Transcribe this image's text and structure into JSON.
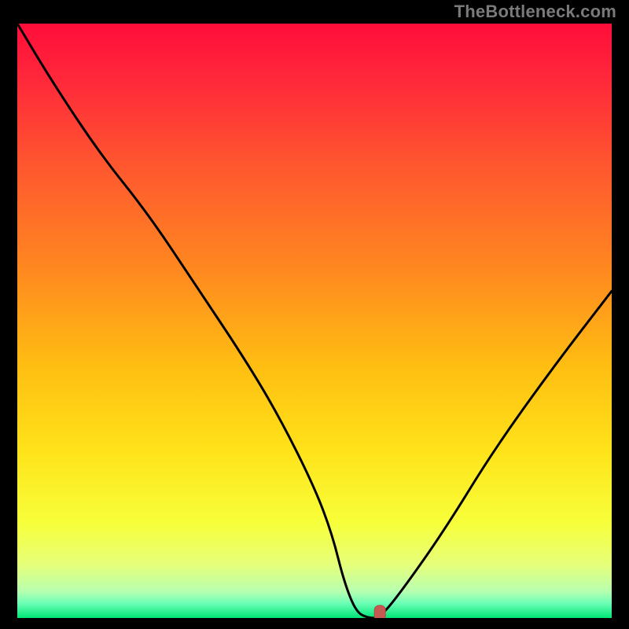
{
  "attribution": "TheBottleneck.com",
  "colors": {
    "frame": "#000000",
    "attribution": "#7a7a7a",
    "curve": "#000000",
    "marker_fill": "#c55a52",
    "marker_stroke": "#b24a43",
    "gradient_stops": [
      {
        "offset": 0.0,
        "color": "#ff0d3a"
      },
      {
        "offset": 0.1,
        "color": "#ff2a3a"
      },
      {
        "offset": 0.25,
        "color": "#ff5a2e"
      },
      {
        "offset": 0.42,
        "color": "#ff8a1f"
      },
      {
        "offset": 0.58,
        "color": "#ffbf12"
      },
      {
        "offset": 0.72,
        "color": "#ffe31a"
      },
      {
        "offset": 0.84,
        "color": "#f7ff3a"
      },
      {
        "offset": 0.91,
        "color": "#e6ff7a"
      },
      {
        "offset": 0.955,
        "color": "#b8ffb0"
      },
      {
        "offset": 0.975,
        "color": "#6dffb6"
      },
      {
        "offset": 1.0,
        "color": "#00e676"
      }
    ]
  },
  "chart_data": {
    "type": "line",
    "title": "",
    "xlabel": "",
    "ylabel": "",
    "xlim": [
      0,
      100
    ],
    "ylim": [
      0,
      100
    ],
    "grid": false,
    "legend": false,
    "series": [
      {
        "name": "bottleneck-curve",
        "x": [
          0,
          6,
          14,
          22,
          30,
          38,
          44,
          50,
          53,
          55,
          57,
          59,
          61,
          65,
          72,
          80,
          90,
          100
        ],
        "values": [
          100,
          90,
          78,
          68,
          56,
          44,
          34,
          22,
          14,
          6,
          1,
          0,
          0,
          5,
          15,
          28,
          42,
          55
        ]
      }
    ],
    "markers": [
      {
        "name": "optimal-point",
        "x": 61,
        "y": 0
      }
    ]
  }
}
